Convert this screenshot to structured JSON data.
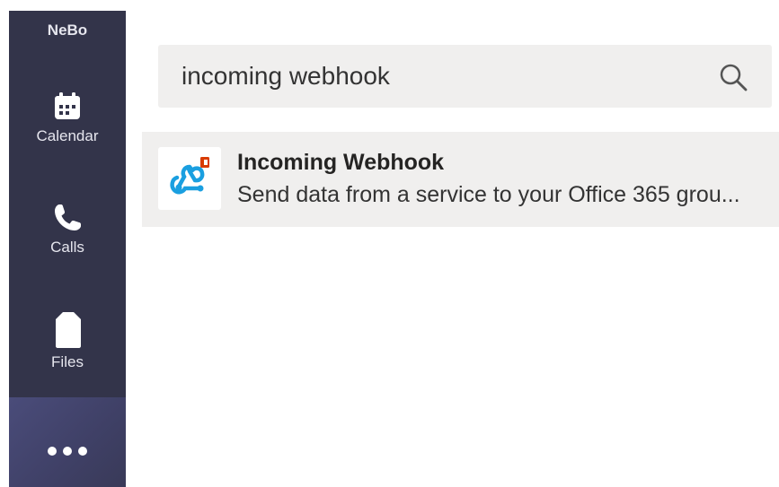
{
  "sidebar": {
    "org_label": "NeBo",
    "items": [
      {
        "label": "Calendar",
        "icon": "calendar-icon"
      },
      {
        "label": "Calls",
        "icon": "phone-icon"
      },
      {
        "label": "Files",
        "icon": "file-icon"
      }
    ],
    "more_icon": "more-dots-icon",
    "colors": {
      "background": "#33344a",
      "active": "#4a4c7a"
    }
  },
  "search": {
    "value": "incoming webhook",
    "icon": "search-icon"
  },
  "results": [
    {
      "title": "Incoming Webhook",
      "description": "Send data from a service to your Office 365 grou...",
      "icon": "webhook-icon"
    }
  ],
  "colors": {
    "search_background": "#f0efee",
    "webhook_accent": "#1a9fe0",
    "office_badge": "#d83b01"
  }
}
